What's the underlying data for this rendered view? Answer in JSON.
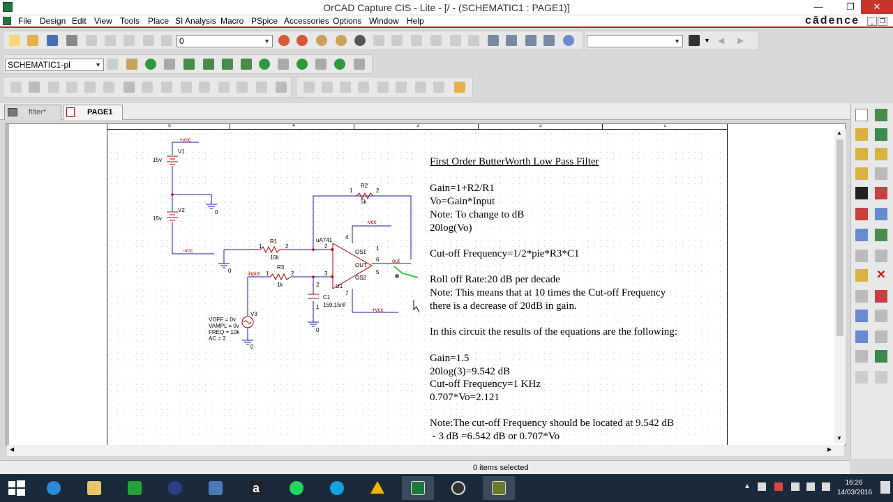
{
  "window": {
    "title": "OrCAD Capture CIS - Lite - [/ - (SCHEMATIC1 : PAGE1)]",
    "brand": "cādence"
  },
  "menu": [
    "File",
    "Design",
    "Edit",
    "View",
    "Tools",
    "Place",
    "SI Analysis",
    "Macro",
    "PSpice",
    "Accessories",
    "Options",
    "Window",
    "Help"
  ],
  "toolbar": {
    "zoom_value": "0",
    "search_value": "",
    "profile_value": "SCHEMATIC1-pl"
  },
  "tabs": [
    {
      "label": "filter*",
      "active": false
    },
    {
      "label": "PAGE1",
      "active": true
    }
  ],
  "ruler": [
    "5",
    "4",
    "3",
    "2",
    "1"
  ],
  "schematic": {
    "labels": {
      "vcc_top": "+vcc",
      "v1": "V1",
      "v1_val": "15v",
      "v2": "V2",
      "v2_val": "15v",
      "gnd0_a": "0",
      "vcc_neg_left": "-vcc",
      "r2": "R2",
      "r2_val": "5k",
      "r2_pin1": "1",
      "r2_pin2": "2",
      "u_name": "uA741",
      "r1": "R1",
      "r1_val": "10k",
      "r1_pin1": "1",
      "r1_pin2": "2",
      "vcc_neg_op": "-vcc",
      "pin2": "2",
      "pin3": "3",
      "pin4": "4",
      "pin7": "7",
      "pin1": "1",
      "pin5": "5",
      "pin6": "6",
      "os1": "OS1",
      "os2": "OS2",
      "out": "OUT",
      "out_net": "out",
      "u1": "U1",
      "gnd0_b": "0",
      "input_net": "input",
      "r3": "R3",
      "r3_val": "1k",
      "r3_pin1": "1",
      "r3_pin2": "2",
      "c1": "C1",
      "c1_val": "159.15nF",
      "c1_pin1": "1",
      "c1_pin2": "2",
      "vcc_pos_op": "+vcc",
      "v3": "V3",
      "voff": "VOFF = 0v",
      "vampl": "VAMPL = 0v",
      "freq": "FREQ = 10k",
      "ac": "AC = 2",
      "gnd0_c": "0",
      "gnd0_d": "0"
    }
  },
  "notes": [
    "First Order ButterWorth Low Pass Filter",
    "Gain=1+R2/R1",
    "Vo=Gain*Input",
    "Note: To change to dB",
    "20log(Vo)",
    "Cut-off Frequency=1/2*pie*R3*C1",
    "Roll off Rate:20 dB per decade",
    "Note: This means that at 10 times the Cut-off Frequency",
    "there is a decrease of 20dB in gain.",
    "In this circuit the results of the equations are the following:",
    "Gain=1.5",
    "20log(3)=9.542 dB",
    "Cut-off Frequency=1 KHz",
    "0.707*Vo=2.121",
    "Note:The cut-off Frequency should be located at 9.542 dB",
    " - 3 dB =6.542 dB or 0.707*Vo"
  ],
  "status": {
    "text": "0 items selected"
  },
  "taskbar": {
    "time": "16:26",
    "date": "14/03/2016"
  },
  "colors": {
    "accent_red": "#c81e1e",
    "taskbar": "#1b2a3a",
    "wire": "#1a1aa0",
    "part": "#b00000"
  }
}
